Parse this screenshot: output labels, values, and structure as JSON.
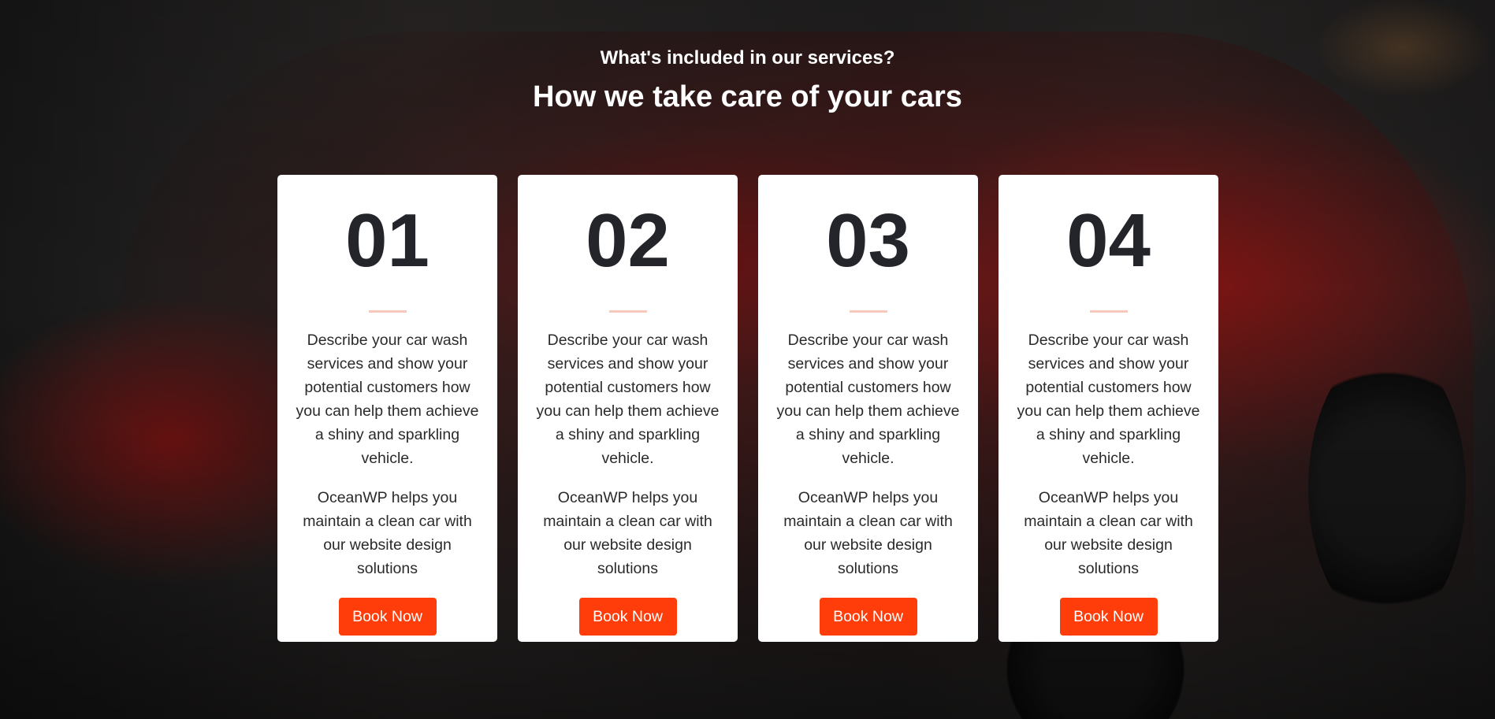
{
  "header": {
    "subtitle": "What's included in our services?",
    "title": "How we take care of your cars"
  },
  "cards": [
    {
      "number": "01",
      "description": "Describe your car wash services and show your potential customers how you can help them achieve a shiny and sparkling vehicle.",
      "note": "OceanWP helps you maintain a clean car with our website design solutions",
      "button_label": "Book Now"
    },
    {
      "number": "02",
      "description": "Describe your car wash services and show your potential customers how you can help them achieve a shiny and sparkling vehicle.",
      "note": "OceanWP helps you maintain a clean car with our website design solutions",
      "button_label": "Book Now"
    },
    {
      "number": "03",
      "description": "Describe your car wash services and show your potential customers how you can help them achieve a shiny and sparkling vehicle.",
      "note": "OceanWP helps you maintain a clean car with our website design solutions",
      "button_label": "Book Now"
    },
    {
      "number": "04",
      "description": "Describe your car wash services and show your potential customers how you can help them achieve a shiny and sparkling vehicle.",
      "note": "OceanWP helps you maintain a clean car with our website design solutions",
      "button_label": "Book Now"
    }
  ],
  "colors": {
    "accent": "#ff3d0a",
    "divider": "#f7c8bc",
    "card_background": "#ffffff",
    "number_text": "#23252b"
  }
}
